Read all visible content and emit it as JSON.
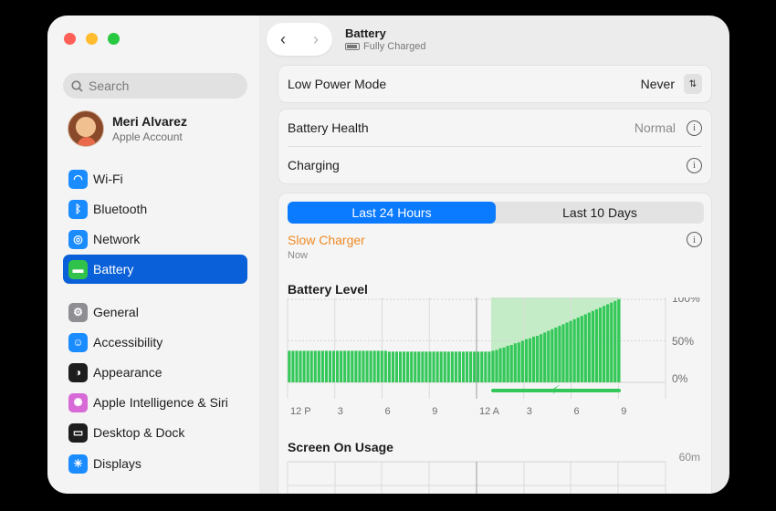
{
  "sidebar": {
    "search_placeholder": "Search",
    "account": {
      "name": "Meri Alvarez",
      "subtitle": "Apple Account"
    },
    "items": [
      {
        "label": "Wi-Fi",
        "icon": "wifi-icon",
        "color": "#1a8cff"
      },
      {
        "label": "Bluetooth",
        "icon": "bluetooth-icon",
        "color": "#1a8cff"
      },
      {
        "label": "Network",
        "icon": "globe-icon",
        "color": "#1a8cff"
      },
      {
        "label": "Battery",
        "icon": "battery-icon",
        "color": "#30c24a",
        "active": true
      },
      {
        "label": "General",
        "icon": "gear-icon",
        "color": "#8e8e93"
      },
      {
        "label": "Accessibility",
        "icon": "accessibility-icon",
        "color": "#1a8cff"
      },
      {
        "label": "Appearance",
        "icon": "appearance-icon",
        "color": "#1d1d1d"
      },
      {
        "label": "Apple Intelligence & Siri",
        "icon": "siri-icon",
        "color": "#d86ad8"
      },
      {
        "label": "Desktop & Dock",
        "icon": "dock-icon",
        "color": "#1d1d1d"
      },
      {
        "label": "Displays",
        "icon": "sun-icon",
        "color": "#1a8cff"
      }
    ]
  },
  "header": {
    "title": "Battery",
    "subtitle": "Fully Charged"
  },
  "settings": {
    "low_power": {
      "label": "Low Power Mode",
      "value": "Never"
    },
    "health": {
      "label": "Battery Health",
      "value": "Normal"
    },
    "charging": {
      "label": "Charging"
    }
  },
  "usage": {
    "tabs": [
      "Last 24 Hours",
      "Last 10 Days"
    ],
    "active_tab": 0,
    "alert": {
      "title": "Slow Charger",
      "time": "Now",
      "color": "#f08a24"
    },
    "level_title": "Battery Level",
    "screen_title": "Screen On Usage",
    "screen_max_label": "60m"
  },
  "chart_data": {
    "type": "bar",
    "title": "Battery Level",
    "x_tick_labels": [
      "12 P",
      "3",
      "6",
      "9",
      "12 A",
      "3",
      "6",
      "9"
    ],
    "y_tick_labels": [
      "100%",
      "50%",
      "0%"
    ],
    "ylim": [
      0,
      100
    ],
    "values": [
      38,
      38,
      38,
      38,
      38,
      38,
      38,
      38,
      38,
      38,
      38,
      38,
      38,
      38,
      38,
      38,
      38,
      38,
      38,
      38,
      38,
      38,
      38,
      38,
      38,
      38,
      38,
      37,
      37,
      37,
      37,
      37,
      37,
      37,
      37,
      37,
      37,
      37,
      37,
      37,
      37,
      37,
      37,
      37,
      37,
      37,
      37,
      37,
      37,
      37,
      37,
      37,
      37,
      37,
      37,
      38,
      39,
      41,
      42,
      44,
      45,
      47,
      48,
      50,
      52,
      53,
      55,
      56,
      58,
      60,
      62,
      64,
      66,
      68,
      70,
      72,
      74,
      76,
      78,
      80,
      82,
      84,
      86,
      88,
      90,
      92,
      94,
      96,
      98,
      100
    ],
    "charging_start_index": 55,
    "colors": {
      "bar": "#34c759",
      "charging_bg": "#c4ecc6"
    }
  }
}
